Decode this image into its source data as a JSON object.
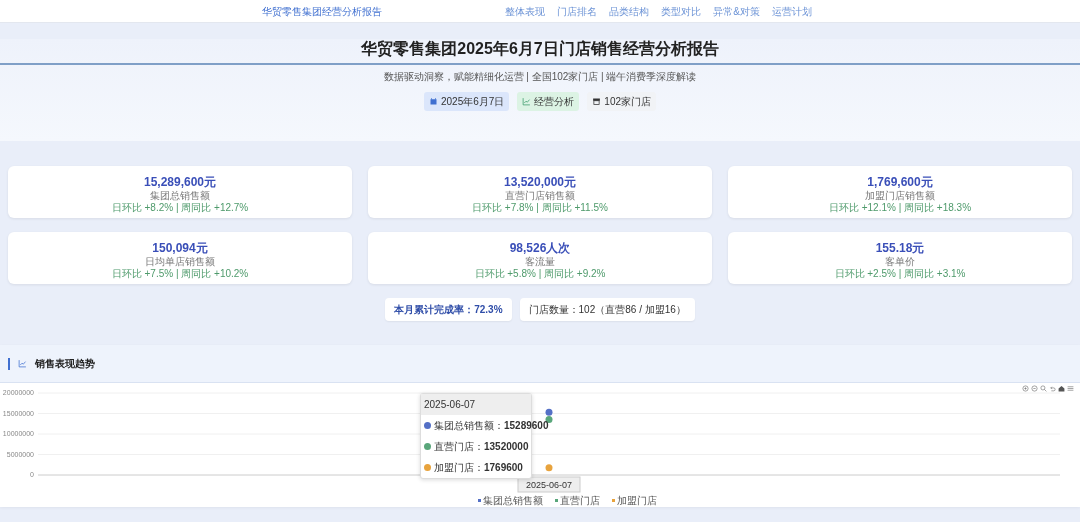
{
  "navbar": {
    "brand": "华贸零售集团经营分析报告",
    "links": [
      {
        "label": "整体表现",
        "selected": false
      },
      {
        "label": "门店排名",
        "selected": false
      },
      {
        "label": "品类结构",
        "selected": false
      },
      {
        "label": "类型对比",
        "selected": false
      },
      {
        "label": "异常&对策",
        "selected": false
      },
      {
        "label": "运营计划",
        "selected": false
      }
    ]
  },
  "header": {
    "title": "华贸零售集团2025年6月7日门店销售经营分析报告",
    "subtitle": "数据驱动洞察，赋能精细化运营 | 全国102家门店 | 端午消费季深度解读",
    "tags": [
      {
        "kind": "calendar",
        "label": "2025年6月7日",
        "color": "#dbe6fb"
      },
      {
        "kind": "chart",
        "label": "经营分析",
        "color": "#dcf3e4"
      },
      {
        "kind": "store",
        "label": "102家门店",
        "color": "#f1f3f6"
      }
    ]
  },
  "kpis": [
    {
      "value": "15,289,600元",
      "label": "集团总销售额",
      "change": "日环比 +8.2% | 周同比 +12.7%"
    },
    {
      "value": "13,520,000元",
      "label": "直营门店销售额",
      "change": "日环比 +7.8% | 周同比 +11.5%"
    },
    {
      "value": "1,769,600元",
      "label": "加盟门店销售额",
      "change": "日环比 +12.1% | 周同比 +18.3%"
    },
    {
      "value": "150,094元",
      "label": "日均单店销售额",
      "change": "日环比 +7.5% | 周同比 +10.2%"
    },
    {
      "value": "98,526人次",
      "label": "客流量",
      "change": "日环比 +5.8% | 周同比 +9.2%"
    },
    {
      "value": "155.18元",
      "label": "客单价",
      "change": "日环比 +2.5% | 周同比 +3.1%"
    }
  ],
  "summary": [
    {
      "text": "本月累计完成率：72.3%",
      "kind": "highlight"
    },
    {
      "text": "门店数量：102（直营86 / 加盟16）",
      "kind": "plain"
    }
  ],
  "trend": {
    "title": "销售表现趋势",
    "chart_data": {
      "type": "line",
      "grid": true,
      "x": [
        "2025-06-07"
      ],
      "ylim": [
        0,
        20000000
      ],
      "yticks": [
        0,
        5000000,
        10000000,
        15000000,
        20000000
      ],
      "series": [
        {
          "name": "集团总销售额",
          "color": "#5470c6",
          "marker": "circle",
          "values": [
            15289600
          ]
        },
        {
          "name": "直营门店",
          "color": "#59a67a",
          "marker": "circle",
          "values": [
            13520000
          ]
        },
        {
          "name": "加盟门店",
          "color": "#e8a33d",
          "marker": "circle",
          "values": [
            1769600
          ]
        }
      ]
    },
    "tooltip": {
      "title": "2025-06-07",
      "items": [
        {
          "name": "集团总销售额：",
          "value": "15289600",
          "color": "#5470c6"
        },
        {
          "name": "直营门店：",
          "value": "13520000",
          "color": "#59a67a"
        },
        {
          "name": "加盟门店：",
          "value": "1769600",
          "color": "#e8a33d"
        }
      ]
    }
  }
}
